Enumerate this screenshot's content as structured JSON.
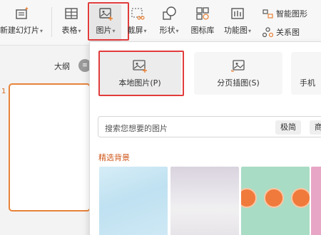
{
  "ribbon": {
    "new_slide": "新建幻灯片",
    "table": "表格",
    "picture": "图片",
    "screenshot": "截屏",
    "shape": "形状",
    "icon_library": "图标库",
    "function_chart": "功能图",
    "smart_graphic": "智能图形",
    "relation_chart": "关系图"
  },
  "left_pane": {
    "outline_label": "大纲",
    "outline_toggle": "≡",
    "slide_number": "1"
  },
  "picture_panel": {
    "local_picture": "本地图片(P)",
    "paged_insert": "分页插图(S)",
    "phone": "手机",
    "search_placeholder": "搜索您想要的图片",
    "filter_1": "极简",
    "filter_2": "商",
    "section_title": "精选背景"
  },
  "colors": {
    "highlight": "#e13c3c",
    "accent_orange": "#d05a1e",
    "slide_border": "#e8833a"
  }
}
